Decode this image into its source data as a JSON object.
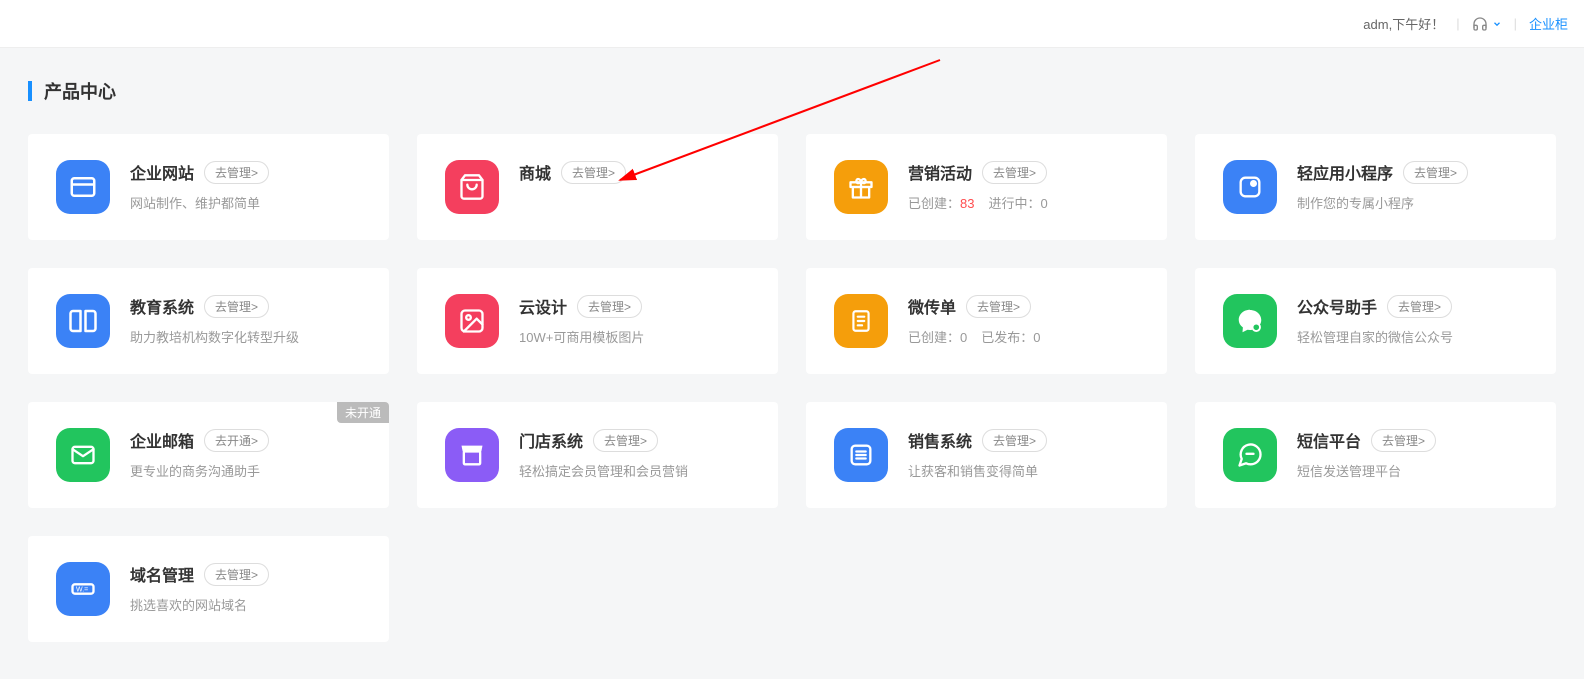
{
  "header": {
    "greeting": "adm,下午好！",
    "link": "企业柜"
  },
  "section_title": "产品中心",
  "cards": [
    {
      "id": "website",
      "title": "企业网站",
      "btn": "去管理>",
      "desc": "网站制作、维护都简单",
      "icon_bg": "#3b82f6",
      "tag": ""
    },
    {
      "id": "mall",
      "title": "商城",
      "btn": "去管理>",
      "desc": "",
      "icon_bg": "#f43f5e",
      "tag": ""
    },
    {
      "id": "marketing",
      "title": "营销活动",
      "btn": "去管理>",
      "desc": "",
      "stats": [
        {
          "label": "已创建：",
          "value": "83",
          "highlight": true
        },
        {
          "label": "进行中：",
          "value": "0",
          "highlight": false
        }
      ],
      "icon_bg": "#f59e0b",
      "tag": ""
    },
    {
      "id": "miniapp",
      "title": "轻应用小程序",
      "btn": "去管理>",
      "desc": "制作您的专属小程序",
      "icon_bg": "#3b82f6",
      "tag": ""
    },
    {
      "id": "edu",
      "title": "教育系统",
      "btn": "去管理>",
      "desc": "助力教培机构数字化转型升级",
      "icon_bg": "#3b82f6",
      "tag": ""
    },
    {
      "id": "design",
      "title": "云设计",
      "btn": "去管理>",
      "desc": "10W+可商用模板图片",
      "icon_bg": "#f43f5e",
      "tag": ""
    },
    {
      "id": "flyer",
      "title": "微传单",
      "btn": "去管理>",
      "desc": "",
      "stats": [
        {
          "label": "已创建：",
          "value": "0",
          "highlight": false
        },
        {
          "label": "已发布：",
          "value": "0",
          "highlight": false
        }
      ],
      "icon_bg": "#f59e0b",
      "tag": ""
    },
    {
      "id": "wechat",
      "title": "公众号助手",
      "btn": "去管理>",
      "desc": "轻松管理自家的微信公众号",
      "icon_bg": "#22c55e",
      "tag": ""
    },
    {
      "id": "email",
      "title": "企业邮箱",
      "btn": "去开通>",
      "desc": "更专业的商务沟通助手",
      "icon_bg": "#22c55e",
      "tag": "未开通"
    },
    {
      "id": "store",
      "title": "门店系统",
      "btn": "去管理>",
      "desc": "轻松搞定会员管理和会员营销",
      "icon_bg": "#8b5cf6",
      "tag": ""
    },
    {
      "id": "sales",
      "title": "销售系统",
      "btn": "去管理>",
      "desc": "让获客和销售变得简单",
      "icon_bg": "#3b82f6",
      "tag": ""
    },
    {
      "id": "sms",
      "title": "短信平台",
      "btn": "去管理>",
      "desc": "短信发送管理平台",
      "icon_bg": "#22c55e",
      "tag": ""
    },
    {
      "id": "domain",
      "title": "域名管理",
      "btn": "去管理>",
      "desc": "挑选喜欢的网站域名",
      "icon_bg": "#3b82f6",
      "tag": ""
    }
  ],
  "icons": {
    "website": "window",
    "mall": "bag",
    "marketing": "gift",
    "miniapp": "app",
    "edu": "book",
    "design": "image",
    "flyer": "doc",
    "wechat": "chat",
    "email": "mail",
    "store": "shop",
    "sales": "list",
    "sms": "message",
    "domain": "tag"
  }
}
